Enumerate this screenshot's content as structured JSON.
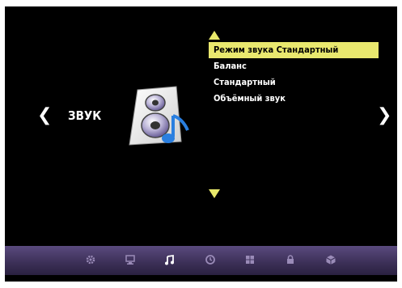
{
  "screen": {
    "title": "ЗВУК"
  },
  "nav": {
    "left_arrow": "❮",
    "right_arrow": "❯"
  },
  "menu": {
    "items": [
      {
        "label": "Режим звука Стандартный",
        "selected": true
      },
      {
        "label": "Баланс"
      },
      {
        "label": "Стандартный"
      },
      {
        "label": "Объёмный звук"
      }
    ]
  },
  "bottom_bar": {
    "icons": [
      {
        "name": "settings-gear-icon"
      },
      {
        "name": "picture-monitor-icon"
      },
      {
        "name": "sound-music-note-icon",
        "active": true
      },
      {
        "name": "timer-clock-icon"
      },
      {
        "name": "grid-channels-icon"
      },
      {
        "name": "lock-icon"
      },
      {
        "name": "cube-option-icon"
      }
    ]
  },
  "colors": {
    "highlight": "#e9e86e",
    "background": "#000000",
    "bar": "#3b2f56"
  }
}
